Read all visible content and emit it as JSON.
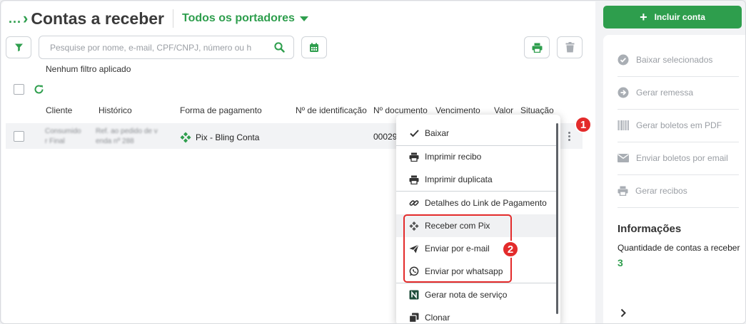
{
  "header": {
    "crumb": "...",
    "title": "Contas a receber",
    "portadores": "Todos os portadores"
  },
  "toolbar": {
    "search_placeholder": "Pesquise por nome, e-mail, CPF/CNPJ, número ou h",
    "no_filter": "Nenhum filtro aplicado"
  },
  "table": {
    "columns": [
      "Cliente",
      "Histórico",
      "Forma de pagamento",
      "Nº de identificação",
      "Nº documento",
      "Vencimento",
      "Valor",
      "Situação"
    ],
    "row": {
      "cliente_line1": "Consumido",
      "cliente_line2": "r Final",
      "historico_line1": "Ref. ao pedido de v",
      "historico_line2": "enda nº 288",
      "forma_pagamento": "Pix - Bling Conta",
      "documento": "00029"
    }
  },
  "menu": {
    "items": [
      {
        "label": "Baixar",
        "icon": "check-icon"
      },
      {
        "label": "Imprimir recibo",
        "icon": "printer-icon"
      },
      {
        "label": "Imprimir duplicata",
        "icon": "printer-icon"
      },
      {
        "label": "Detalhes do Link de Pagamento",
        "icon": "link-icon"
      },
      {
        "label": "Receber com Pix",
        "icon": "pix-icon"
      },
      {
        "label": "Enviar por e-mail",
        "icon": "send-icon"
      },
      {
        "label": "Enviar por whatsapp",
        "icon": "whatsapp-icon"
      },
      {
        "label": "Gerar nota de serviço",
        "icon": "nota-icon"
      },
      {
        "label": "Clonar",
        "icon": "clone-icon"
      }
    ]
  },
  "annotations": {
    "badge1": "1",
    "badge2": "2"
  },
  "sidebar": {
    "incluir": "Incluir conta",
    "actions": [
      {
        "label": "Baixar selecionados",
        "icon": "check-circle-icon"
      },
      {
        "label": "Gerar remessa",
        "icon": "arrow-circle-icon"
      },
      {
        "label": "Gerar boletos em PDF",
        "icon": "barcode-icon"
      },
      {
        "label": "Enviar boletos por email",
        "icon": "envelope-icon"
      },
      {
        "label": "Gerar recibos",
        "icon": "printer-icon"
      }
    ],
    "info_title": "Informações",
    "info_label": "Quantidade de contas a receber",
    "info_value": "3"
  },
  "colors": {
    "accent": "#2e9e4d",
    "annotation": "#e32b2b",
    "muted": "#9a9ea4"
  }
}
